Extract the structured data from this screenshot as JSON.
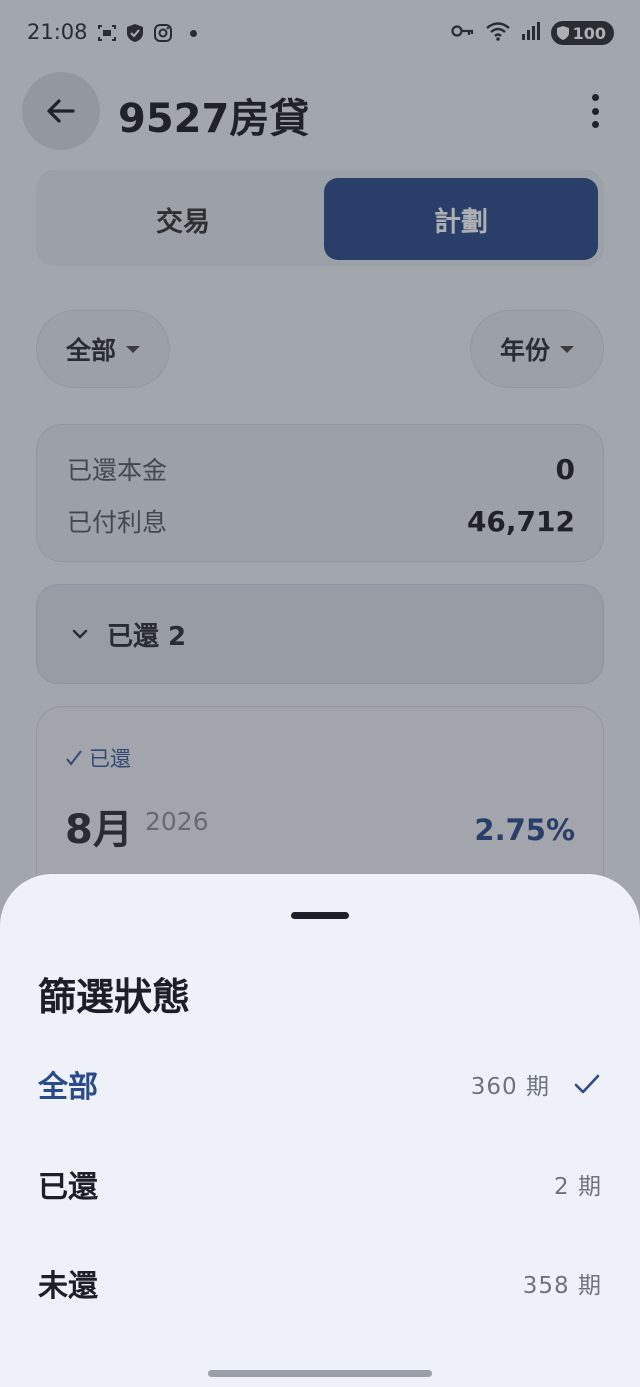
{
  "status_bar": {
    "time": "21:08",
    "battery": "100"
  },
  "app_bar": {
    "title": "9527房貸"
  },
  "tabs": [
    {
      "label": "交易",
      "selected": false
    },
    {
      "label": "計劃",
      "selected": true
    }
  ],
  "filters": {
    "status_label": "全部",
    "period_label": "年份"
  },
  "summary": {
    "principal_label": "已還本金",
    "principal_value": "0",
    "interest_label": "已付利息",
    "interest_value": "46,712"
  },
  "paid_group": {
    "label": "已還 2"
  },
  "schedule_card": {
    "paid_tag": "已還",
    "month": "8月",
    "year": "2026",
    "rate": "2.75%"
  },
  "sheet": {
    "title": "篩選狀態",
    "options": [
      {
        "label": "全部",
        "count": "360 期",
        "selected": true
      },
      {
        "label": "已還",
        "count": "2 期",
        "selected": false
      },
      {
        "label": "未還",
        "count": "358 期",
        "selected": false
      }
    ]
  },
  "colors": {
    "accent": "#2b4a8a",
    "background": "#eef2f8"
  }
}
